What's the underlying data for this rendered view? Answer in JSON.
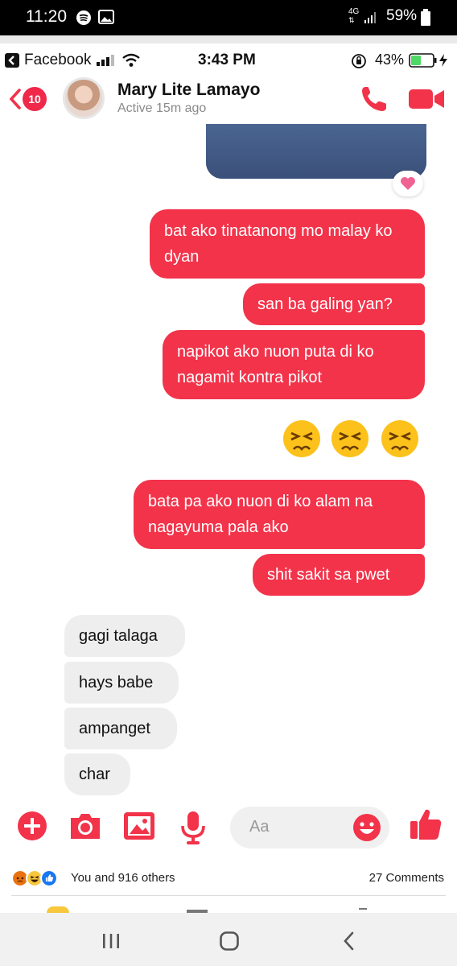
{
  "android_status": {
    "time": "11:20",
    "network": "4G",
    "battery": "59%"
  },
  "ios_status": {
    "back_app": "Facebook",
    "time": "3:43 PM",
    "battery": "43%"
  },
  "header": {
    "unread_count": "10",
    "contact_name": "Mary Lite Lamayo",
    "active_status": "Active 15m ago"
  },
  "messages": {
    "out": [
      "bat ako tinatanong mo malay ko dyan",
      "san ba galing yan?",
      "napikot ako nuon puta di ko nagamit kontra pikot",
      "bata pa ako nuon di ko alam na nagayuma pala ako",
      "shit sakit sa pwet"
    ],
    "in": [
      "gagi talaga",
      "hays babe",
      "ampanget",
      "char"
    ]
  },
  "composer": {
    "placeholder": "Aa"
  },
  "post": {
    "reactions_text": "You and 916 others",
    "comments_text": "27 Comments"
  },
  "colors": {
    "accent": "#f2334a",
    "incoming_bubble": "#eeeeee"
  }
}
